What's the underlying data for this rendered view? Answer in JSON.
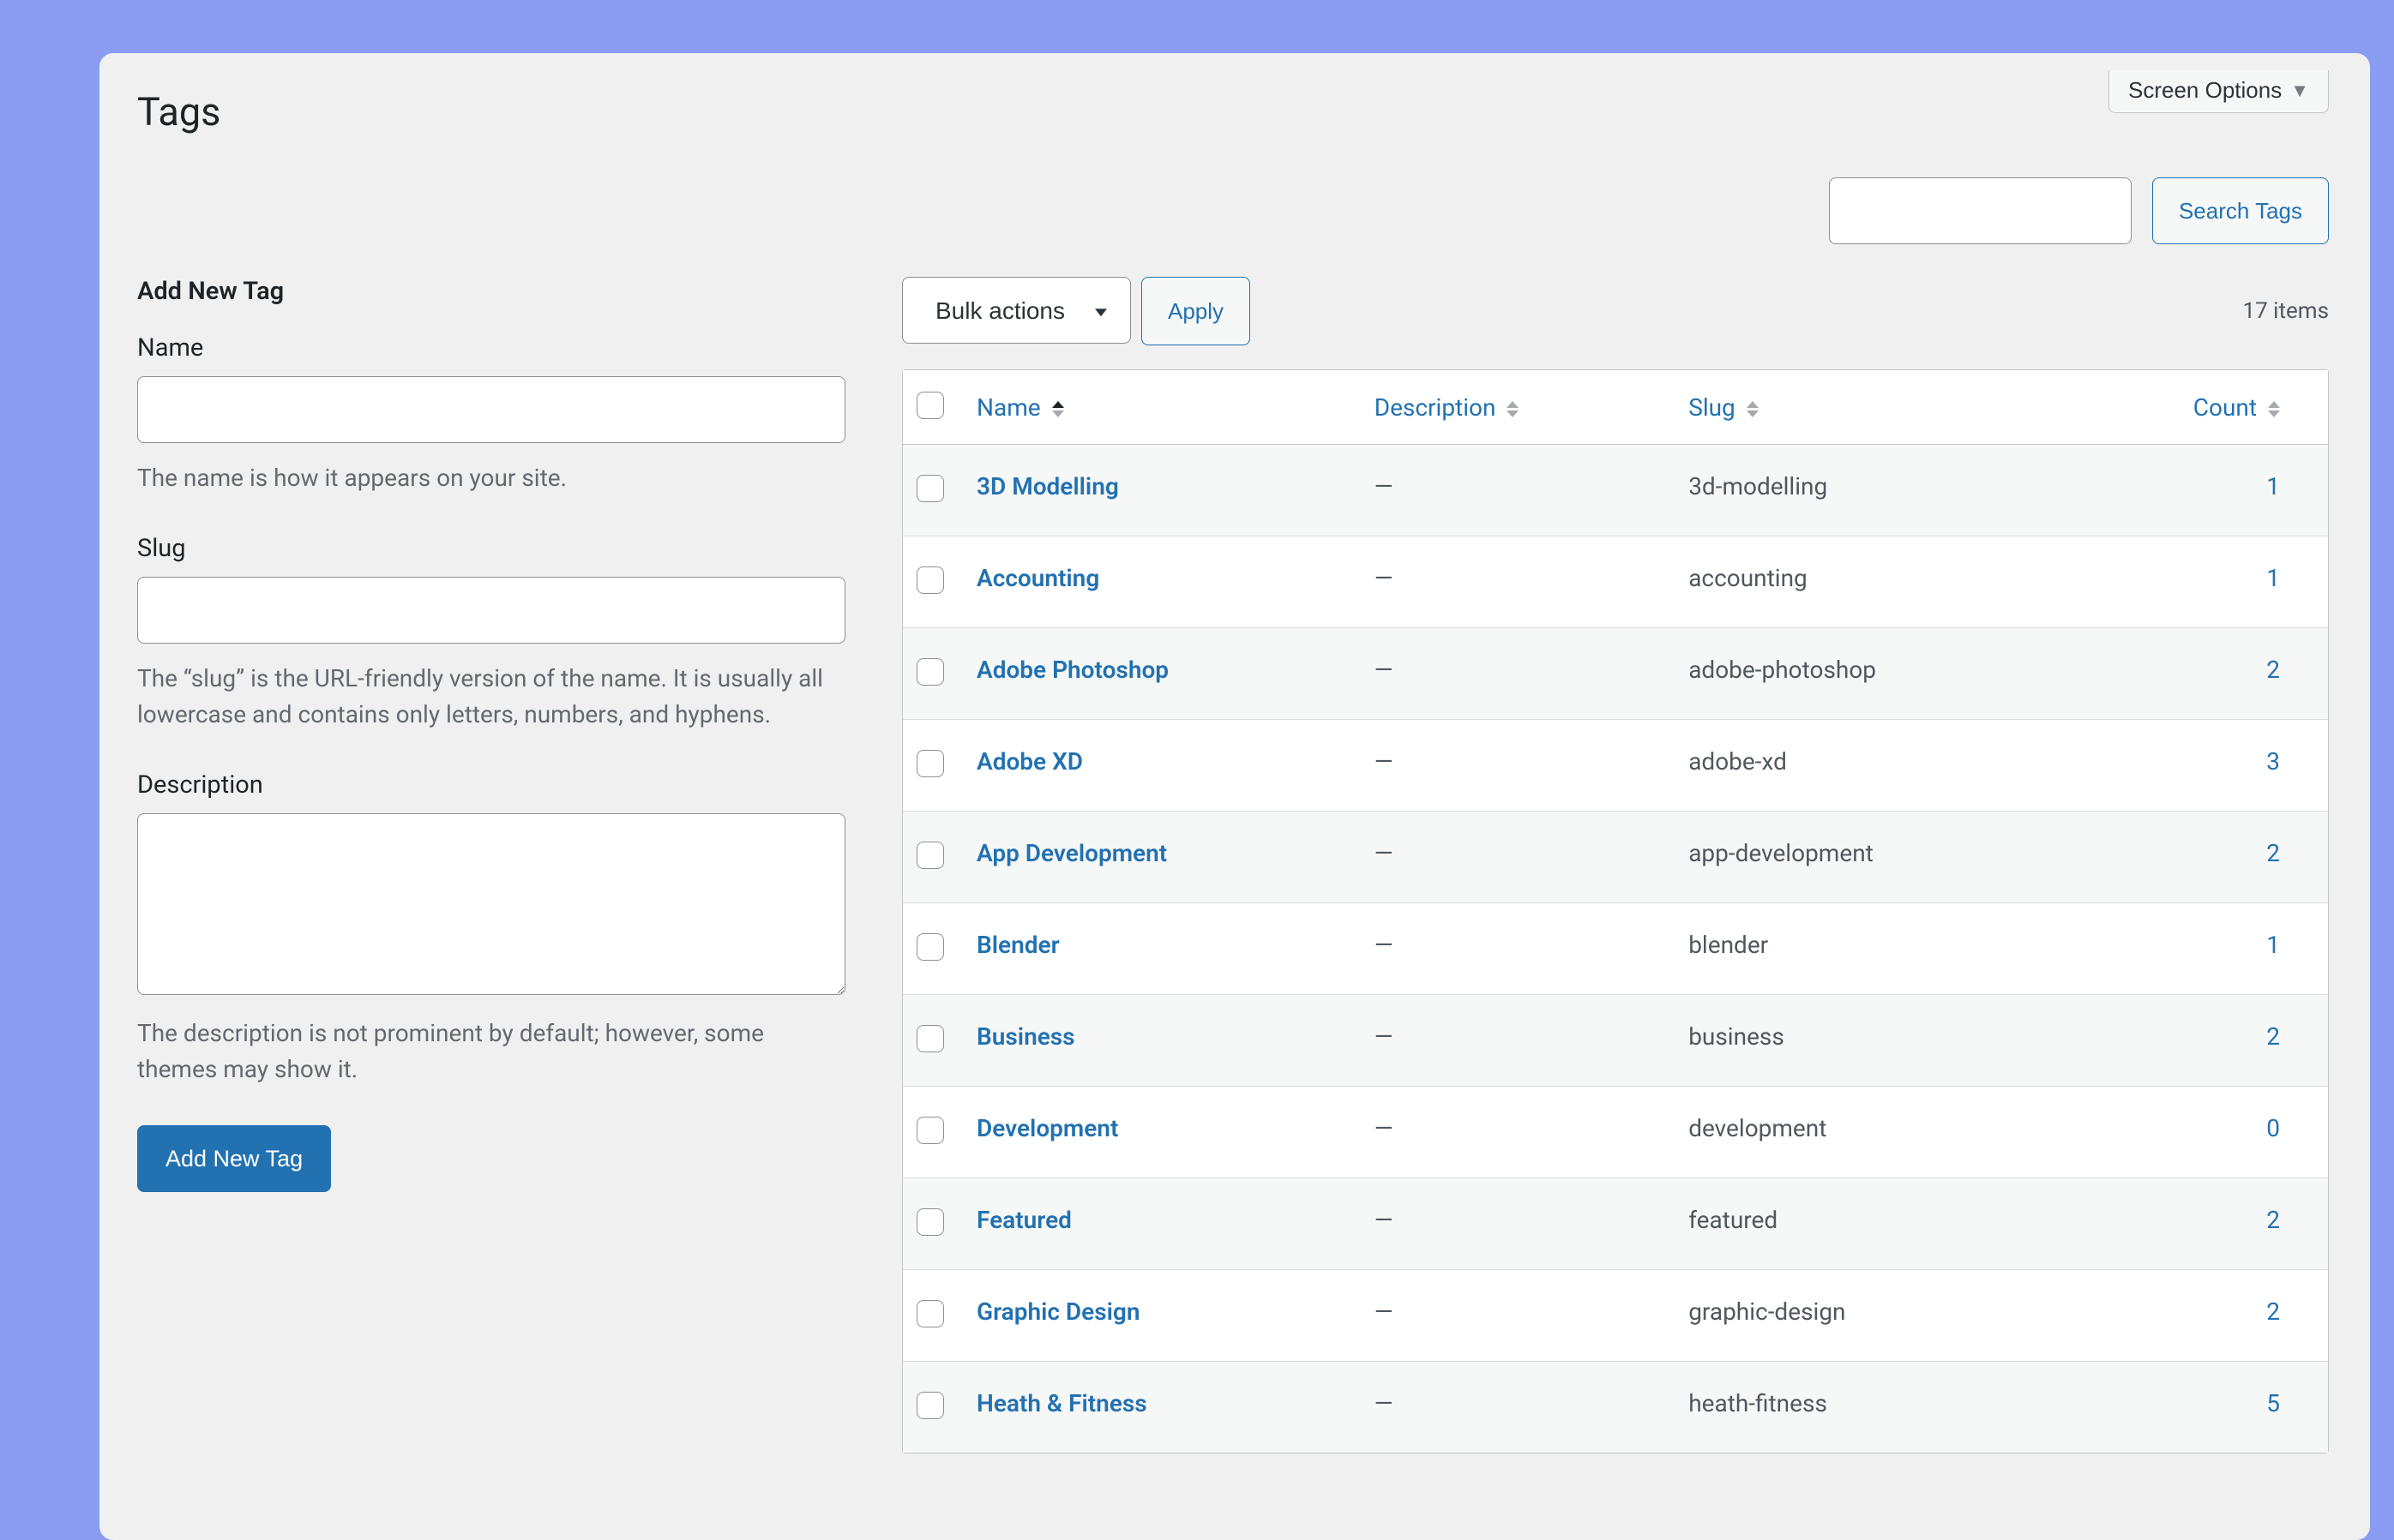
{
  "header": {
    "page_title": "Tags",
    "screen_options": "Screen Options"
  },
  "search": {
    "input_value": "",
    "button": "Search Tags"
  },
  "form": {
    "title": "Add New Tag",
    "name_label": "Name",
    "name_value": "",
    "name_hint": "The name is how it appears on your site.",
    "slug_label": "Slug",
    "slug_value": "",
    "slug_hint": "The “slug” is the URL-friendly version of the name. It is usually all lowercase and contains only letters, numbers, and hyphens.",
    "desc_label": "Description",
    "desc_value": "",
    "desc_hint": "The description is not prominent by default; however, some themes may show it.",
    "submit": "Add New Tag"
  },
  "table": {
    "bulk_actions_label": "Bulk actions",
    "apply_label": "Apply",
    "item_count": "17 items",
    "cols": {
      "name": "Name",
      "description": "Description",
      "slug": "Slug",
      "count": "Count"
    },
    "rows": [
      {
        "name": "3D Modelling",
        "description": "—",
        "slug": "3d-modelling",
        "count": "1"
      },
      {
        "name": "Accounting",
        "description": "—",
        "slug": "accounting",
        "count": "1"
      },
      {
        "name": "Adobe Photoshop",
        "description": "—",
        "slug": "adobe-photoshop",
        "count": "2"
      },
      {
        "name": "Adobe XD",
        "description": "—",
        "slug": "adobe-xd",
        "count": "3"
      },
      {
        "name": "App Development",
        "description": "—",
        "slug": "app-development",
        "count": "2"
      },
      {
        "name": "Blender",
        "description": "—",
        "slug": "blender",
        "count": "1"
      },
      {
        "name": "Business",
        "description": "—",
        "slug": "business",
        "count": "2"
      },
      {
        "name": "Development",
        "description": "—",
        "slug": "development",
        "count": "0"
      },
      {
        "name": "Featured",
        "description": "—",
        "slug": "featured",
        "count": "2"
      },
      {
        "name": "Graphic Design",
        "description": "—",
        "slug": "graphic-design",
        "count": "2"
      },
      {
        "name": "Heath & Fitness",
        "description": "—",
        "slug": "heath-fitness",
        "count": "5"
      }
    ]
  }
}
